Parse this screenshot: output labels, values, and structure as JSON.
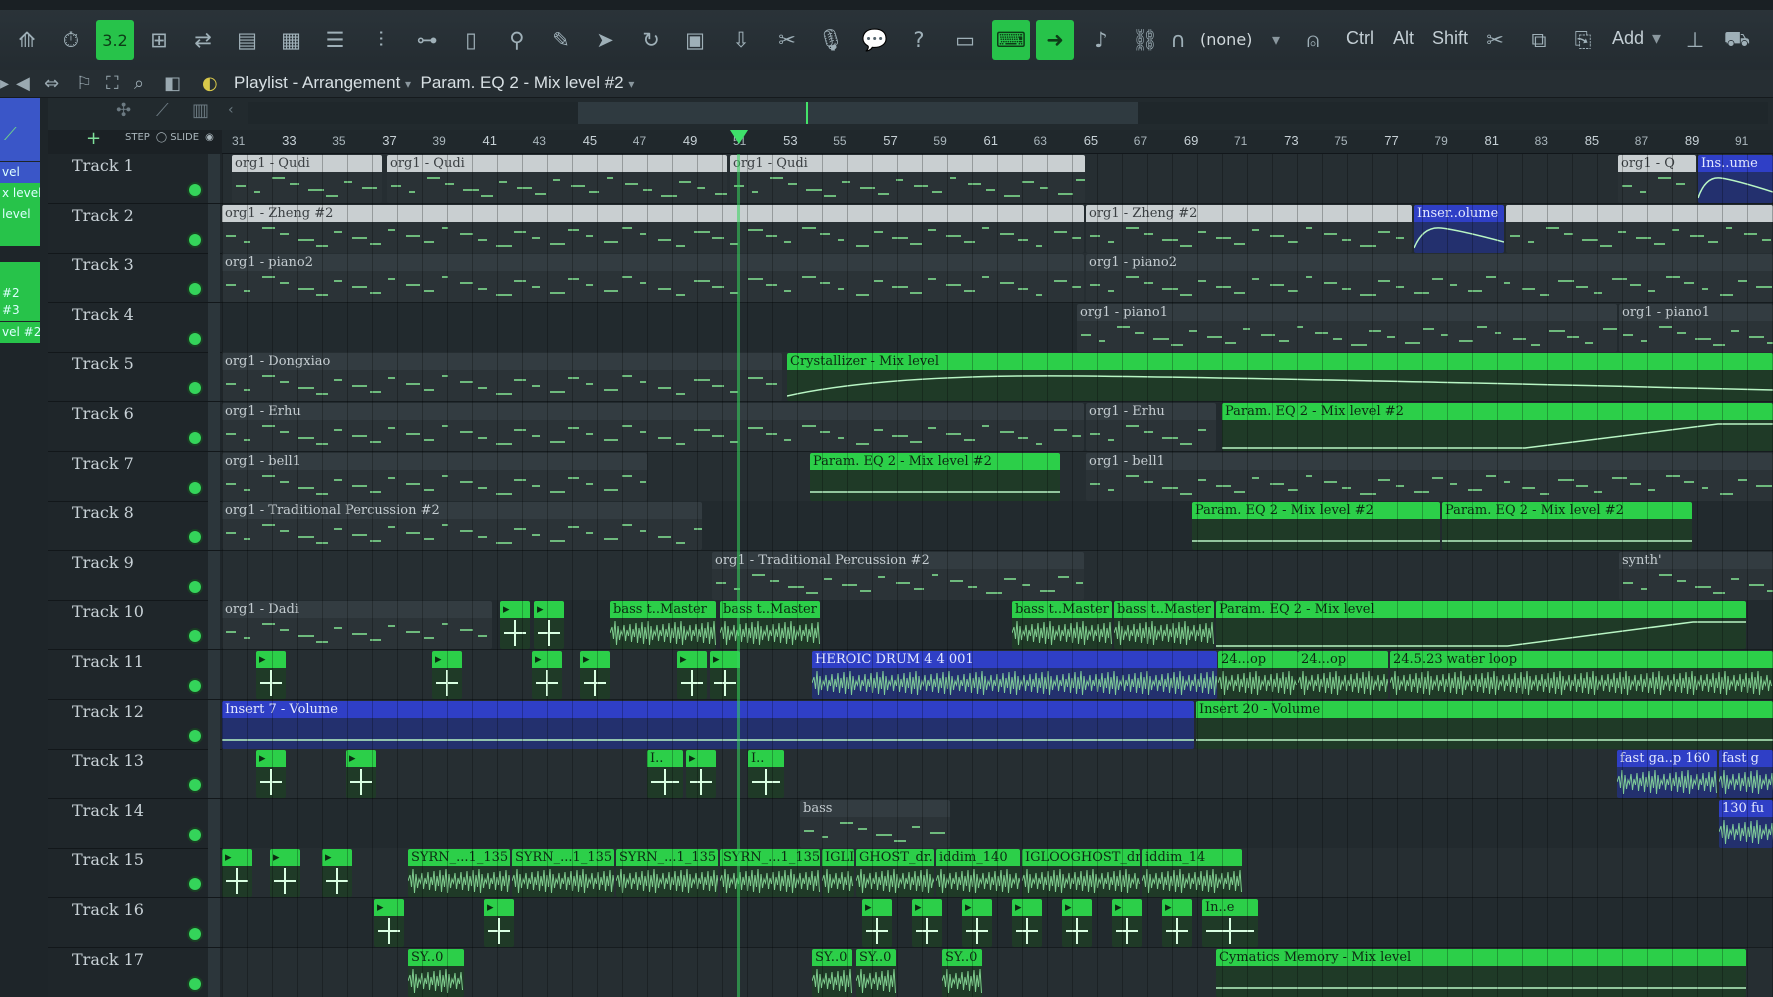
{
  "toolbar": {
    "tempo_display": "3.2",
    "none_select": "(none)",
    "ctrl": "Ctrl",
    "alt": "Alt",
    "shift": "Shift",
    "add": "Add"
  },
  "playlist": {
    "title": "Playlist - Arrangement",
    "target": "Param. EQ 2 - Mix level #2"
  },
  "left_picker": [
    "vel",
    "x level",
    "level",
    "",
    "",
    "#2",
    "#3",
    "vel #2"
  ],
  "ruler": {
    "step": "STEP",
    "slide": "SLIDE",
    "ticks": [
      "31",
      "33",
      "35",
      "37",
      "39",
      "41",
      "43",
      "45",
      "47",
      "49",
      "51",
      "53",
      "55",
      "57",
      "59",
      "61",
      "63",
      "65",
      "67",
      "69",
      "71",
      "73",
      "75",
      "77",
      "79",
      "81",
      "83",
      "85",
      "87",
      "89",
      "91"
    ]
  },
  "tracks": [
    "Track 1",
    "Track 2",
    "Track 3",
    "Track 4",
    "Track 5",
    "Track 6",
    "Track 7",
    "Track 8",
    "Track 9",
    "Track 10",
    "Track 11",
    "Track 12",
    "Track 13",
    "Track 14",
    "Track 15",
    "Track 16",
    "Track 17"
  ],
  "clips": {
    "t1a": "org1 - Qudi",
    "t1b": "org1 - Qudi",
    "t1c": "org1 - Qudi",
    "t1d": "org1 - Q",
    "t1e": "Ins..ume",
    "t2a": "org1 - Zheng #2",
    "t2b": "org1 - Zheng #2",
    "t2c": "Inser..olume",
    "t3a": "org1 - piano2",
    "t3b": "org1 - piano2",
    "t4a": "org1 - piano1",
    "t4b": "org1 - piano1",
    "t5a": "org1 - Dongxiao",
    "t5b": "Crystallizer - Mix level",
    "t6a": "org1 - Erhu",
    "t6b": "org1 - Erhu",
    "t6c": "Param. EQ 2 - Mix level #2",
    "t7a": "org1 - bell1",
    "t7b": "Param. EQ 2 - Mix level #2",
    "t7c": "org1 - bell1",
    "t8a": "org1 - Traditional Percussion #2",
    "t8b": "Param. EQ 2 - Mix level #2",
    "t8c": "Param. EQ 2 - Mix level #2",
    "t9a": "org1 - Traditional Percussion #2",
    "t9b": "synth'",
    "t10a": "org1 - Dadi",
    "t10b": "bass t..Master",
    "t10c": "bass t..Master",
    "t10d": "bass t..Master",
    "t10e": "bass t..Master",
    "t10f": "Param. EQ 2 - Mix level",
    "t11a": "HEROIC DRUM   4 4    001",
    "t11b": "24...op",
    "t11c": "24...op",
    "t11d": "24.5.23 water loop",
    "t12a": "Insert 7 - Volume",
    "t12b": "Insert 20 - Volume",
    "t13a": "I..",
    "t13b": "I..",
    "t13c": "fast ga..p 160",
    "t13d": "fast g",
    "t14a": "bass",
    "t14b": "130 fu",
    "t15a": "SYRN_...1_135",
    "t15b": "SYRN_...1_135",
    "t15c": "SYRN_...1_135",
    "t15d": "SYRN_...1_135",
    "t15e": "IGLI",
    "t15f": "GHOST_dr..e",
    "t15g": "iddim_140",
    "t15h": "IGLOOGHOST_dr..e",
    "t15i": "iddim_14",
    "t16a": "In..e",
    "t17a": "SY..0",
    "t17b": "SY..0",
    "t17c": "SY..0",
    "t17d": "SY..0",
    "t17e": "Cymatics Memory - Mix level"
  },
  "colors": {
    "accent_green": "#2ccf49",
    "automation_blue": "#2f3fc6",
    "pattern_grey": "#c9cfd1",
    "background": "#242c30"
  }
}
